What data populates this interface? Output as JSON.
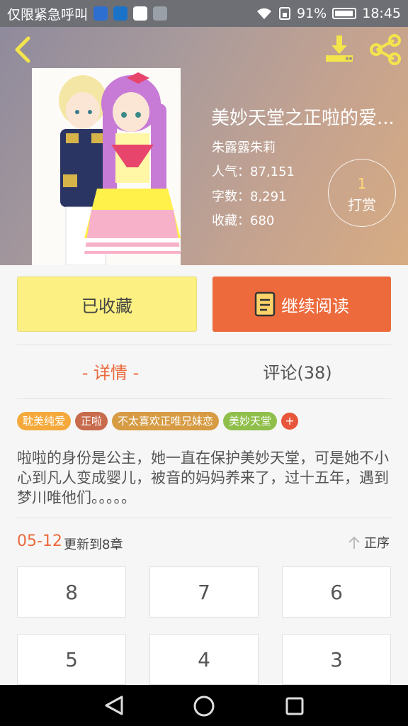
{
  "status_bar": {
    "emergency_text": "仅限紧急呼叫",
    "battery": "91%",
    "time": "18:45",
    "app_icons": [
      "app-icon-blue-k",
      "app-icon-blue",
      "qq-icon",
      "image-icon"
    ]
  },
  "header": {
    "icons": [
      "back-arrow-icon",
      "download-icon",
      "share-icon"
    ]
  },
  "book": {
    "title": "美妙天堂之正啦的爱...",
    "author": "朱露露朱莉",
    "popularity": "人气：87,151",
    "word_count": "字数：8,291",
    "collections": "收藏：680",
    "reward_count": "1",
    "reward_label": "打赏"
  },
  "actions": {
    "collected_label": "已收藏",
    "read_label": "继续阅读"
  },
  "tabs": {
    "detail": "- 详情 -",
    "comments": "评论(38)"
  },
  "tags": [
    "耽美纯爱",
    "正啦",
    "不太喜欢正唯兄妹恋",
    "美妙天堂"
  ],
  "tag_add": "+",
  "colors": {
    "accent": "#ec6a3c",
    "tag_colors": [
      "#f4a93a",
      "#c86a4c",
      "#d69b43",
      "#8fbf4a"
    ],
    "collect_button": "#fbf081"
  },
  "synopsis": "啦啦的身份是公主，她一直在保护美妙天堂，可是她不小心到凡人变成婴儿，被音的妈妈养来了，过十五年，遇到梦川唯他们。。。。。",
  "update": {
    "date": "05-12",
    "text": "更新到8章",
    "sort_label": "正序"
  },
  "chapters": [
    "8",
    "7",
    "6",
    "5",
    "4",
    "3"
  ],
  "nav": [
    "back-triangle-icon",
    "home-circle-icon",
    "recent-square-icon"
  ]
}
